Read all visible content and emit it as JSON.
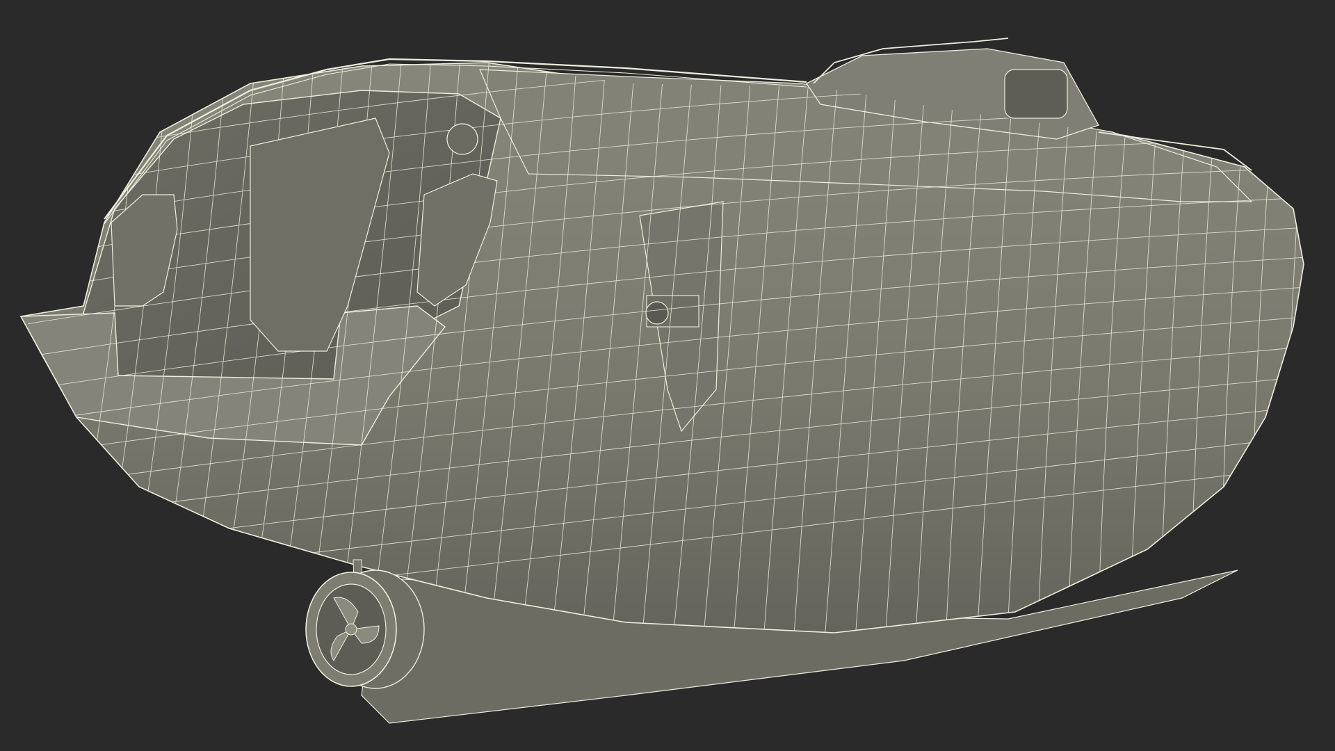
{
  "scene": {
    "background_color": "#2a2a2a",
    "subject": "lifeboat-wireframe-model",
    "render_mode": "wireframe-on-shaded",
    "colors": {
      "hull_fill": "#7b7b70",
      "hull_shadow": "#616158",
      "hull_light": "#8a8a7e",
      "wire": "#eeeede",
      "detail_dark": "#55554d"
    }
  }
}
